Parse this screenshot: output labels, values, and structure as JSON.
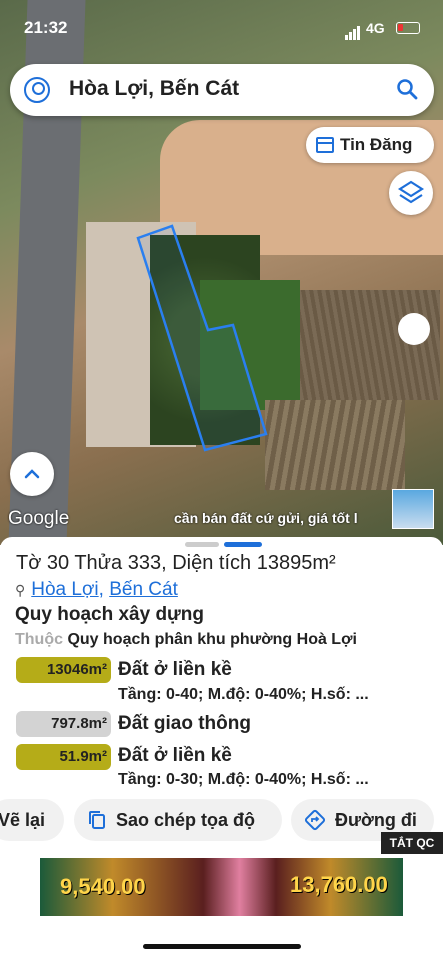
{
  "status_bar": {
    "time": "21:32",
    "network": "4G"
  },
  "search": {
    "title": "Hòa Lợi, Bến Cát"
  },
  "map": {
    "news_button": "Tin Đăng",
    "attribution": "Google",
    "banner": "cần bán đất cứ gửi, giá tốt l"
  },
  "sheet": {
    "parcel": "Tờ 30 Thửa 333, Diện tích 13895m²",
    "ward": "Hòa Lợi",
    "separator": ",",
    "district": "Bến Cát",
    "section_title": "Quy hoạch xây dựng",
    "plan_prefix": "Thuộc",
    "plan_name": "Quy hoạch phân khu phường Hoà Lợi",
    "zones": [
      {
        "area": "13046m²",
        "name": "Đất ở liền kề",
        "detail": "Tầng: 0-40; M.độ: 0-40%; H.số: ...",
        "color": "#b5ac18"
      },
      {
        "area": "797.8m²",
        "name": "Đất giao thông",
        "detail": "",
        "color": "#d3d3d3"
      },
      {
        "area": "51.9m²",
        "name": "Đất ở liền kề",
        "detail": "Tầng: 0-30; M.độ: 0-40%; H.số: ...",
        "color": "#b5ac18"
      }
    ],
    "actions": {
      "back": "Vẽ lại",
      "copy": "Sao chép tọa độ",
      "directions": "Đường đi"
    }
  },
  "ads": {
    "label": "TẮT QC",
    "left_amount": "9,540.00",
    "right_amount": "13,760.00"
  },
  "colors": {
    "accent": "#1e6fd9",
    "parcel_outline": "#2a7ff0"
  }
}
